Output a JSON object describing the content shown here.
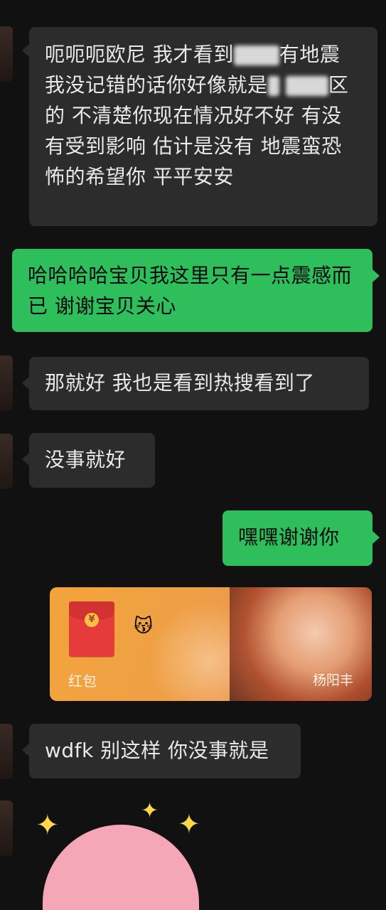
{
  "messages": [
    {
      "side": "in",
      "text_parts": [
        "呃呃呃欧尼 我才看到",
        "有地震 我没记错的话你好像就是",
        "区的 不清楚你现在情况好不好 有没有受到影响 估计是没有 地震蛮恐怖的希望你 平平安安"
      ]
    },
    {
      "side": "out",
      "text": "哈哈哈哈宝贝我这里只有一点震感而已 谢谢宝贝关心"
    },
    {
      "side": "in",
      "text": "那就好 我也是看到热搜看到了"
    },
    {
      "side": "in",
      "text": "没事就好"
    },
    {
      "side": "out",
      "text": "嘿嘿谢谢你"
    },
    {
      "side": "out",
      "type": "red_packet",
      "label": "红包",
      "brand": "杨阳丰",
      "emoji": "😽",
      "coin_symbol": "¥"
    },
    {
      "side": "in",
      "text": "wdfk 别这样 你没事就是"
    }
  ],
  "sticker": {
    "icon": "heart-sticker-icon",
    "sparkle": "✦"
  },
  "colors": {
    "background": "#111111",
    "incoming_bubble": "#2c2c2c",
    "outgoing_bubble": "#2fbe5c",
    "red_packet": "#f3a33a"
  }
}
